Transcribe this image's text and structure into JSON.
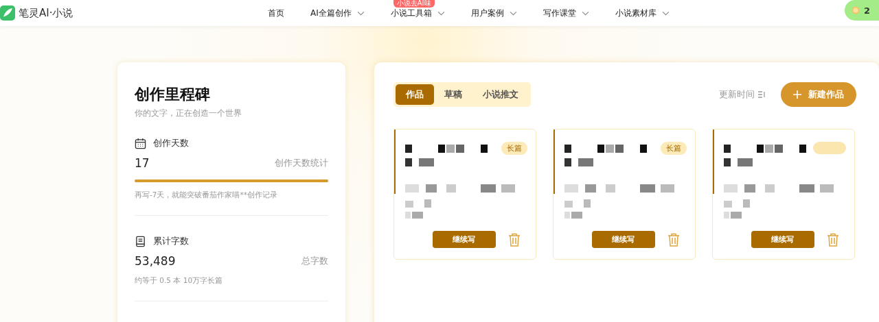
{
  "header": {
    "logo_text": "笔灵AI·小说",
    "nav": [
      {
        "label": "首页",
        "dropdown": false
      },
      {
        "label": "AI全篇创作",
        "dropdown": true
      },
      {
        "label": "小说工具箱",
        "dropdown": true,
        "badge": "小说去AI味"
      },
      {
        "label": "用户案例",
        "dropdown": true
      },
      {
        "label": "写作课堂",
        "dropdown": true
      },
      {
        "label": "小说素材库",
        "dropdown": true
      }
    ],
    "points": "2"
  },
  "milestone": {
    "title": "创作里程碑",
    "subtitle": "你的文字，正在创造一个世界",
    "stats": [
      {
        "kind": "days",
        "label": "创作天数",
        "value": "17",
        "caption": "创作天数统计",
        "level": 1,
        "note": "再写-7天，就能突破番茄作家喵**创作记录"
      },
      {
        "kind": "words",
        "label": "累计字数",
        "value": "53,489",
        "caption": "总字数",
        "note": "约等于 0.5 本 10万字长篇"
      }
    ]
  },
  "works": {
    "tabs": [
      {
        "label": "作品",
        "selected": true
      },
      {
        "label": "草稿",
        "selected": false
      },
      {
        "label": "小说推文",
        "selected": false
      }
    ],
    "sort": "更新时间",
    "new_button": "新建作品",
    "cards": [
      {
        "tag": "长篇",
        "button": "继续写"
      },
      {
        "tag": "长篇",
        "button": "继续写"
      },
      {
        "button": "继续写"
      }
    ]
  }
}
